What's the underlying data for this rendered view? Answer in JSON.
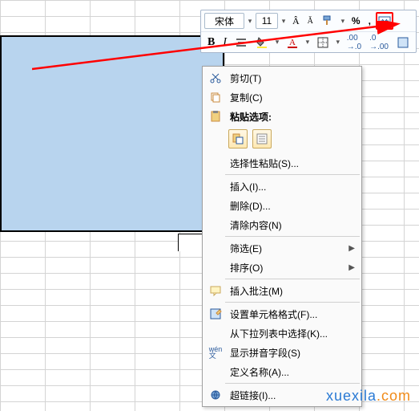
{
  "toolbar": {
    "font_name": "宋体",
    "font_size": "11",
    "bold": "B",
    "italic": "I"
  },
  "context_menu": {
    "cut": "剪切(T)",
    "copy": "复制(C)",
    "paste_header": "粘贴选项:",
    "paste_special": "选择性粘贴(S)...",
    "insert": "插入(I)...",
    "delete": "删除(D)...",
    "clear": "清除内容(N)",
    "filter": "筛选(E)",
    "sort": "排序(O)",
    "comment": "插入批注(M)",
    "format": "设置单元格格式(F)...",
    "dropdown": "从下拉列表中选择(K)...",
    "pinyin": "显示拼音字段(S)",
    "define_name": "定义名称(A)...",
    "hyperlink": "超链接(I)..."
  },
  "watermark": {
    "part1": "xuexila",
    "part2": ".com"
  }
}
